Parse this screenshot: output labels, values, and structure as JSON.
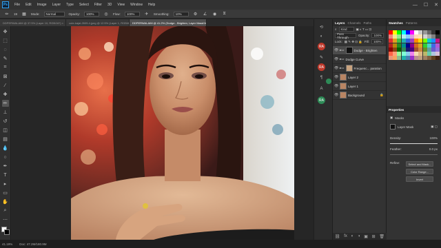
{
  "menubar": {
    "logo": "Ps",
    "items": [
      "File",
      "Edit",
      "Image",
      "Layer",
      "Type",
      "Select",
      "Filter",
      "3D",
      "View",
      "Window",
      "Help"
    ],
    "window_controls": [
      "—",
      "☐",
      "✕"
    ]
  },
  "options": {
    "mode_label": "Mode:",
    "mode_value": "Normal",
    "opacity_label": "Opacity:",
    "opacity_value": "100%",
    "flow_label": "Flow:",
    "flow_value": "100%",
    "smoothing_label": "Smoothing:",
    "smoothing_value": "10%",
    "brush_size": "19"
  },
  "doc_tabs": [
    {
      "label": "DDPERWALAIM @ 37.5% (Layer 10, RGB/16*) ×",
      "active": false
    },
    {
      "label": "cute-kajal-2609-4.jpeg @ 12.5% (Layer 1, RGB/8)* ×",
      "active": false
    },
    {
      "label": "DDPERWALAIM @ 41.2% (Dodge - Brighten, Layer Mask/16)* ×",
      "active": true
    }
  ],
  "tools": [
    {
      "icon": "move-icon",
      "glyph": "✥"
    },
    {
      "icon": "marquee-icon",
      "glyph": "⬚"
    },
    {
      "icon": "lasso-icon",
      "glyph": "◌"
    },
    {
      "icon": "quick-select-icon",
      "glyph": "✎"
    },
    {
      "icon": "crop-icon",
      "glyph": "⌗"
    },
    {
      "icon": "frame-icon",
      "glyph": "⊠"
    },
    {
      "icon": "eyedropper-icon",
      "glyph": "⁄"
    },
    {
      "icon": "healing-icon",
      "glyph": "✚"
    },
    {
      "icon": "brush-icon",
      "glyph": "✏"
    },
    {
      "icon": "stamp-icon",
      "glyph": "⊥"
    },
    {
      "icon": "history-brush-icon",
      "glyph": "↺"
    },
    {
      "icon": "eraser-icon",
      "glyph": "◫"
    },
    {
      "icon": "gradient-icon",
      "glyph": "▤"
    },
    {
      "icon": "blur-icon",
      "glyph": "💧"
    },
    {
      "icon": "dodge-icon",
      "glyph": "○"
    },
    {
      "icon": "pen-icon",
      "glyph": "✒"
    },
    {
      "icon": "type-icon",
      "glyph": "T"
    },
    {
      "icon": "path-select-icon",
      "glyph": "▸"
    },
    {
      "icon": "shape-icon",
      "glyph": "▭"
    },
    {
      "icon": "hand-icon",
      "glyph": "✋"
    },
    {
      "icon": "zoom-icon",
      "glyph": "⌕"
    },
    {
      "icon": "more-tools-icon",
      "glyph": "⋯"
    }
  ],
  "dock": {
    "badges": [
      "RA",
      "RA",
      "RA"
    ]
  },
  "layers_panel": {
    "tabs": [
      "Layers",
      "Channels",
      "Paths"
    ],
    "search_value": "Kind",
    "blend_mode": "Pass Through",
    "opacity_label": "Opacity:",
    "opacity_value": "100%",
    "lock_label": "Lock:",
    "fill_label": "Fill:",
    "fill_value": "100%",
    "layers": [
      {
        "name": "Dodge - Brighten",
        "selected": true,
        "thumb": "#111111"
      },
      {
        "name": "Dodge Curve",
        "selected": false,
        "thumb": "#7a7a7a"
      },
      {
        "name": "Frequenc... paration",
        "selected": false,
        "thumb": "#c9a37f"
      },
      {
        "name": "Layer 2",
        "selected": false,
        "thumb": "#b98563"
      },
      {
        "name": "Layer 1",
        "selected": false,
        "thumb": "#b98563"
      },
      {
        "name": "Background",
        "selected": false,
        "thumb": "#b98563"
      }
    ],
    "bottom_icons": [
      "⛓",
      "fx",
      "◐",
      "◑",
      "▣",
      "⊞",
      "🗑"
    ]
  },
  "swatches_panel": {
    "tabs": [
      "Swatches",
      "Patterns"
    ],
    "colors": [
      "#ff0000",
      "#ffff00",
      "#00ff00",
      "#00ffff",
      "#0000ff",
      "#ff00ff",
      "#ffffff",
      "#cccccc",
      "#999999",
      "#666666",
      "#333333",
      "#000000",
      "#f08080",
      "#f0e68c",
      "#90ee90",
      "#afeeee",
      "#87cefa",
      "#dda0dd",
      "#ffdab9",
      "#ffe4b5",
      "#d3d3d3",
      "#a9a9a9",
      "#808080",
      "#2f2f2f",
      "#e03030",
      "#e0a020",
      "#40c040",
      "#20b0b0",
      "#3060e0",
      "#a040c0",
      "#ff8c00",
      "#ffd700",
      "#7cfc00",
      "#00ced1",
      "#1e90ff",
      "#c71585",
      "#b22222",
      "#b8860b",
      "#228b22",
      "#008b8b",
      "#00008b",
      "#8b008b",
      "#d2691e",
      "#daa520",
      "#32cd32",
      "#48d1cc",
      "#4169e1",
      "#ba55d3",
      "#8b0000",
      "#8b4513",
      "#006400",
      "#2e8b57",
      "#191970",
      "#4b0082",
      "#a0522d",
      "#cd853f",
      "#6b8e23",
      "#5f9ea0",
      "#6a5acd",
      "#9370db",
      "#ff6347",
      "#ffa07a",
      "#98fb98",
      "#7fffd4",
      "#87ceeb",
      "#ee82ee",
      "#f5deb3",
      "#deb887",
      "#bdb76b",
      "#66cdaa",
      "#b0c4de",
      "#d8bfd8",
      "#e9967a",
      "#f4a460",
      "#8fbc8f",
      "#20b2aa",
      "#4682b4",
      "#9932cc",
      "#bc8f8f",
      "#c0a080",
      "#a08060",
      "#806040",
      "#604020",
      "#402010"
    ]
  },
  "properties": {
    "title": "Properties",
    "masks_label": "Masks",
    "layer_mask_label": "Layer Mask",
    "density_label": "Density:",
    "density_value": "100%",
    "density_fraction": 1.0,
    "feather_label": "Feather:",
    "feather_value": "0.0 px",
    "feather_fraction": 0.0,
    "refine_label": "Refine:",
    "buttons": [
      "Select and Mask...",
      "Color Range...",
      "Invert"
    ]
  },
  "status": {
    "zoom": "41.19%",
    "doc_info": "Doc: 47.2M/180.9M"
  }
}
